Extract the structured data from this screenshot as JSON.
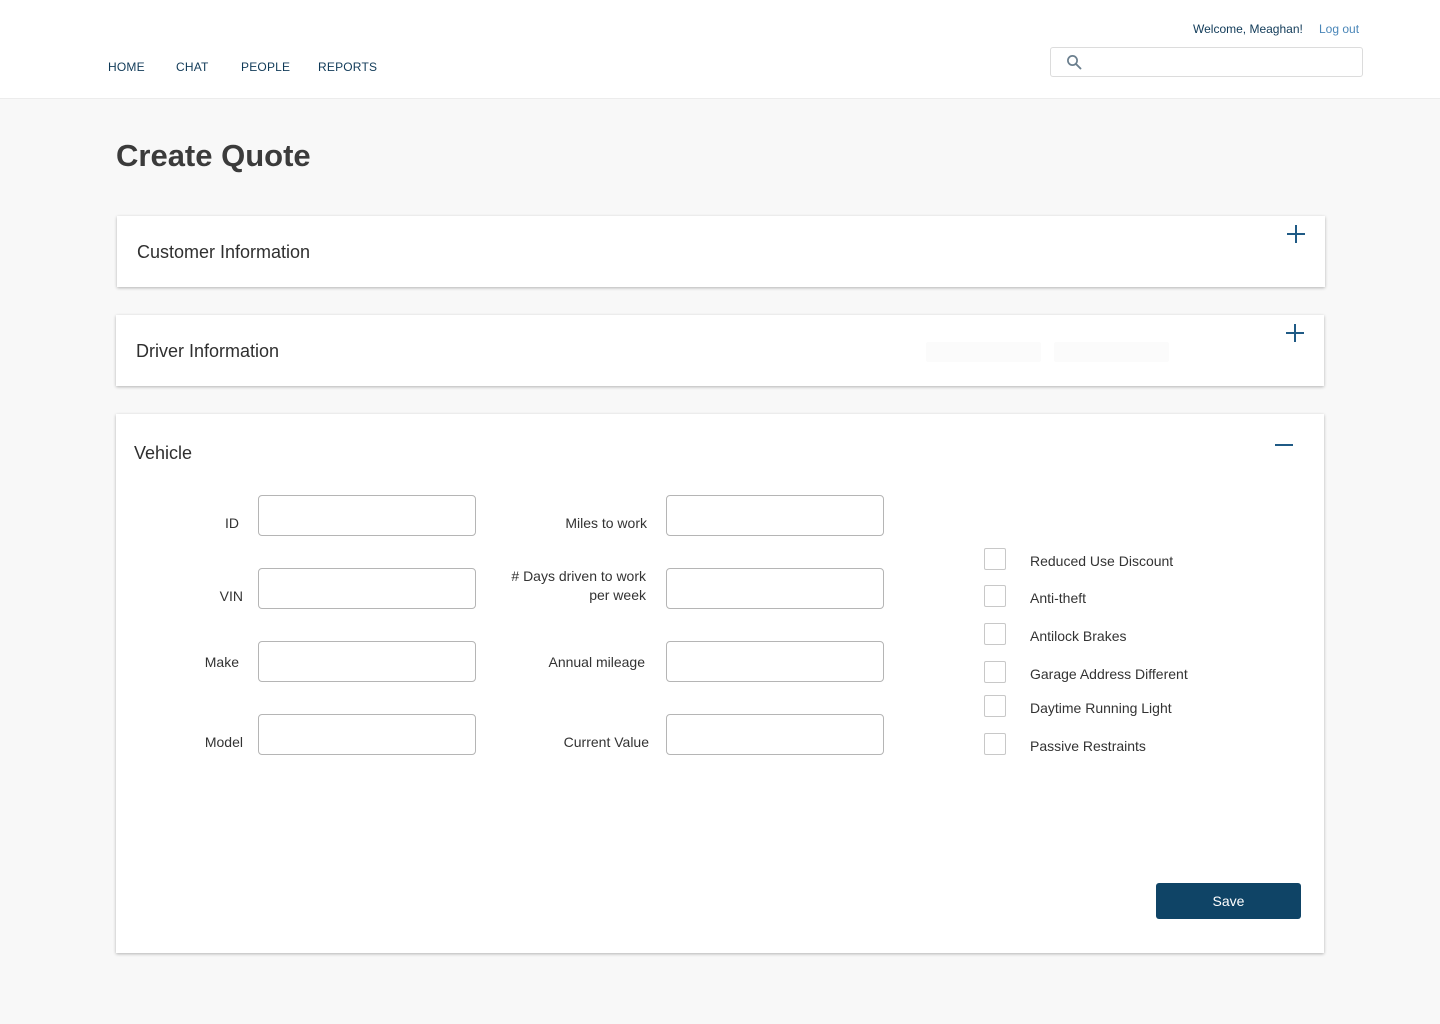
{
  "header": {
    "welcome": "Welcome, Meaghan!",
    "logout_label": "Log out",
    "nav": [
      "HOME",
      "CHAT",
      "PEOPLE",
      "REPORTS"
    ],
    "search": {
      "value": "",
      "placeholder": "",
      "icon": "search-icon"
    }
  },
  "page": {
    "title": "Create Quote"
  },
  "panels": {
    "customer": {
      "title": "Customer Information",
      "toggle_icon": "plus-icon",
      "expanded": false
    },
    "driver": {
      "title": "Driver Information",
      "toggle_icon": "plus-icon",
      "expanded": false
    },
    "vehicle": {
      "title": "Vehicle",
      "toggle_icon": "minus-icon",
      "expanded": true
    }
  },
  "vehicle_form": {
    "left_fields": [
      {
        "label": "ID",
        "value": ""
      },
      {
        "label": "VIN",
        "value": ""
      },
      {
        "label": "Make",
        "value": ""
      },
      {
        "label": "Model",
        "value": ""
      }
    ],
    "middle_fields": [
      {
        "label": "Miles to work",
        "value": ""
      },
      {
        "label": "# Days driven to work per week",
        "value": ""
      },
      {
        "label": "Annual mileage",
        "value": ""
      },
      {
        "label": "Current Value",
        "value": ""
      }
    ],
    "options": [
      {
        "label": "Reduced Use Discount",
        "checked": false
      },
      {
        "label": "Anti-theft",
        "checked": false
      },
      {
        "label": "Antilock Brakes",
        "checked": false
      },
      {
        "label": "Garage Address Different",
        "checked": false
      },
      {
        "label": "Daytime Running Light",
        "checked": false
      },
      {
        "label": "Passive Restraints",
        "checked": false
      }
    ],
    "save_label": "Save"
  },
  "colors": {
    "primary": "#0f4466",
    "nav_text": "#103a58",
    "link": "#4a86b8",
    "page_bg": "#f8f8f8",
    "toggle": "#1f5a85"
  }
}
